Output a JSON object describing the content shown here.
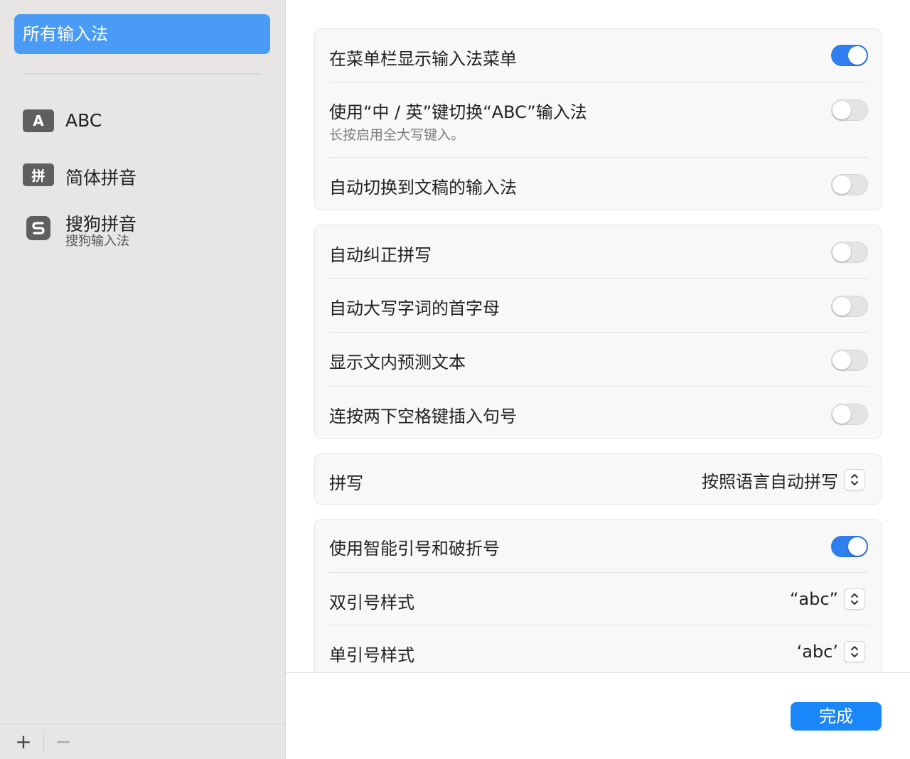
{
  "sidebar": {
    "all_label": "所有输入法",
    "items": [
      {
        "icon_name": "a-letter-icon",
        "icon_text": "A",
        "name": "ABC",
        "sub": ""
      },
      {
        "icon_name": "pin-character-icon",
        "icon_text": "拼",
        "name": "简体拼音",
        "sub": ""
      },
      {
        "icon_name": "sogou-logo-icon",
        "icon_text": "",
        "name": "搜狗拼音",
        "sub": "搜狗输入法"
      }
    ],
    "footer": {
      "add": "+",
      "remove": "−"
    }
  },
  "groups": {
    "menu": {
      "show_menu": {
        "label": "在菜单栏显示输入法菜单",
        "on": true
      },
      "switch_key": {
        "label": "使用“中 / 英”键切换“ABC”输入法",
        "sub": "长按启用全大写键入。",
        "on": false
      },
      "auto_switch": {
        "label": "自动切换到文稿的输入法",
        "on": false
      }
    },
    "typing": {
      "autocorrect": {
        "label": "自动纠正拼写",
        "on": false
      },
      "capitalize": {
        "label": "自动大写字词的首字母",
        "on": false
      },
      "predictive": {
        "label": "显示文内预测文本",
        "on": false
      },
      "double_space": {
        "label": "连按两下空格键插入句号",
        "on": false
      }
    },
    "spelling": {
      "label": "拼写",
      "value": "按照语言自动拼写"
    },
    "quotes": {
      "smart": {
        "label": "使用智能引号和破折号",
        "on": true
      },
      "double": {
        "label": "双引号样式",
        "value": "“abc”"
      },
      "single": {
        "label": "单引号样式",
        "value": "‘abc’"
      }
    }
  },
  "done_label": "完成",
  "colors": {
    "accent": "#1a87fb",
    "sidebar_selected": "#4a9bf5",
    "toggle_on": "#2f7ff0",
    "sidebar_bg": "#e7e6e5"
  }
}
